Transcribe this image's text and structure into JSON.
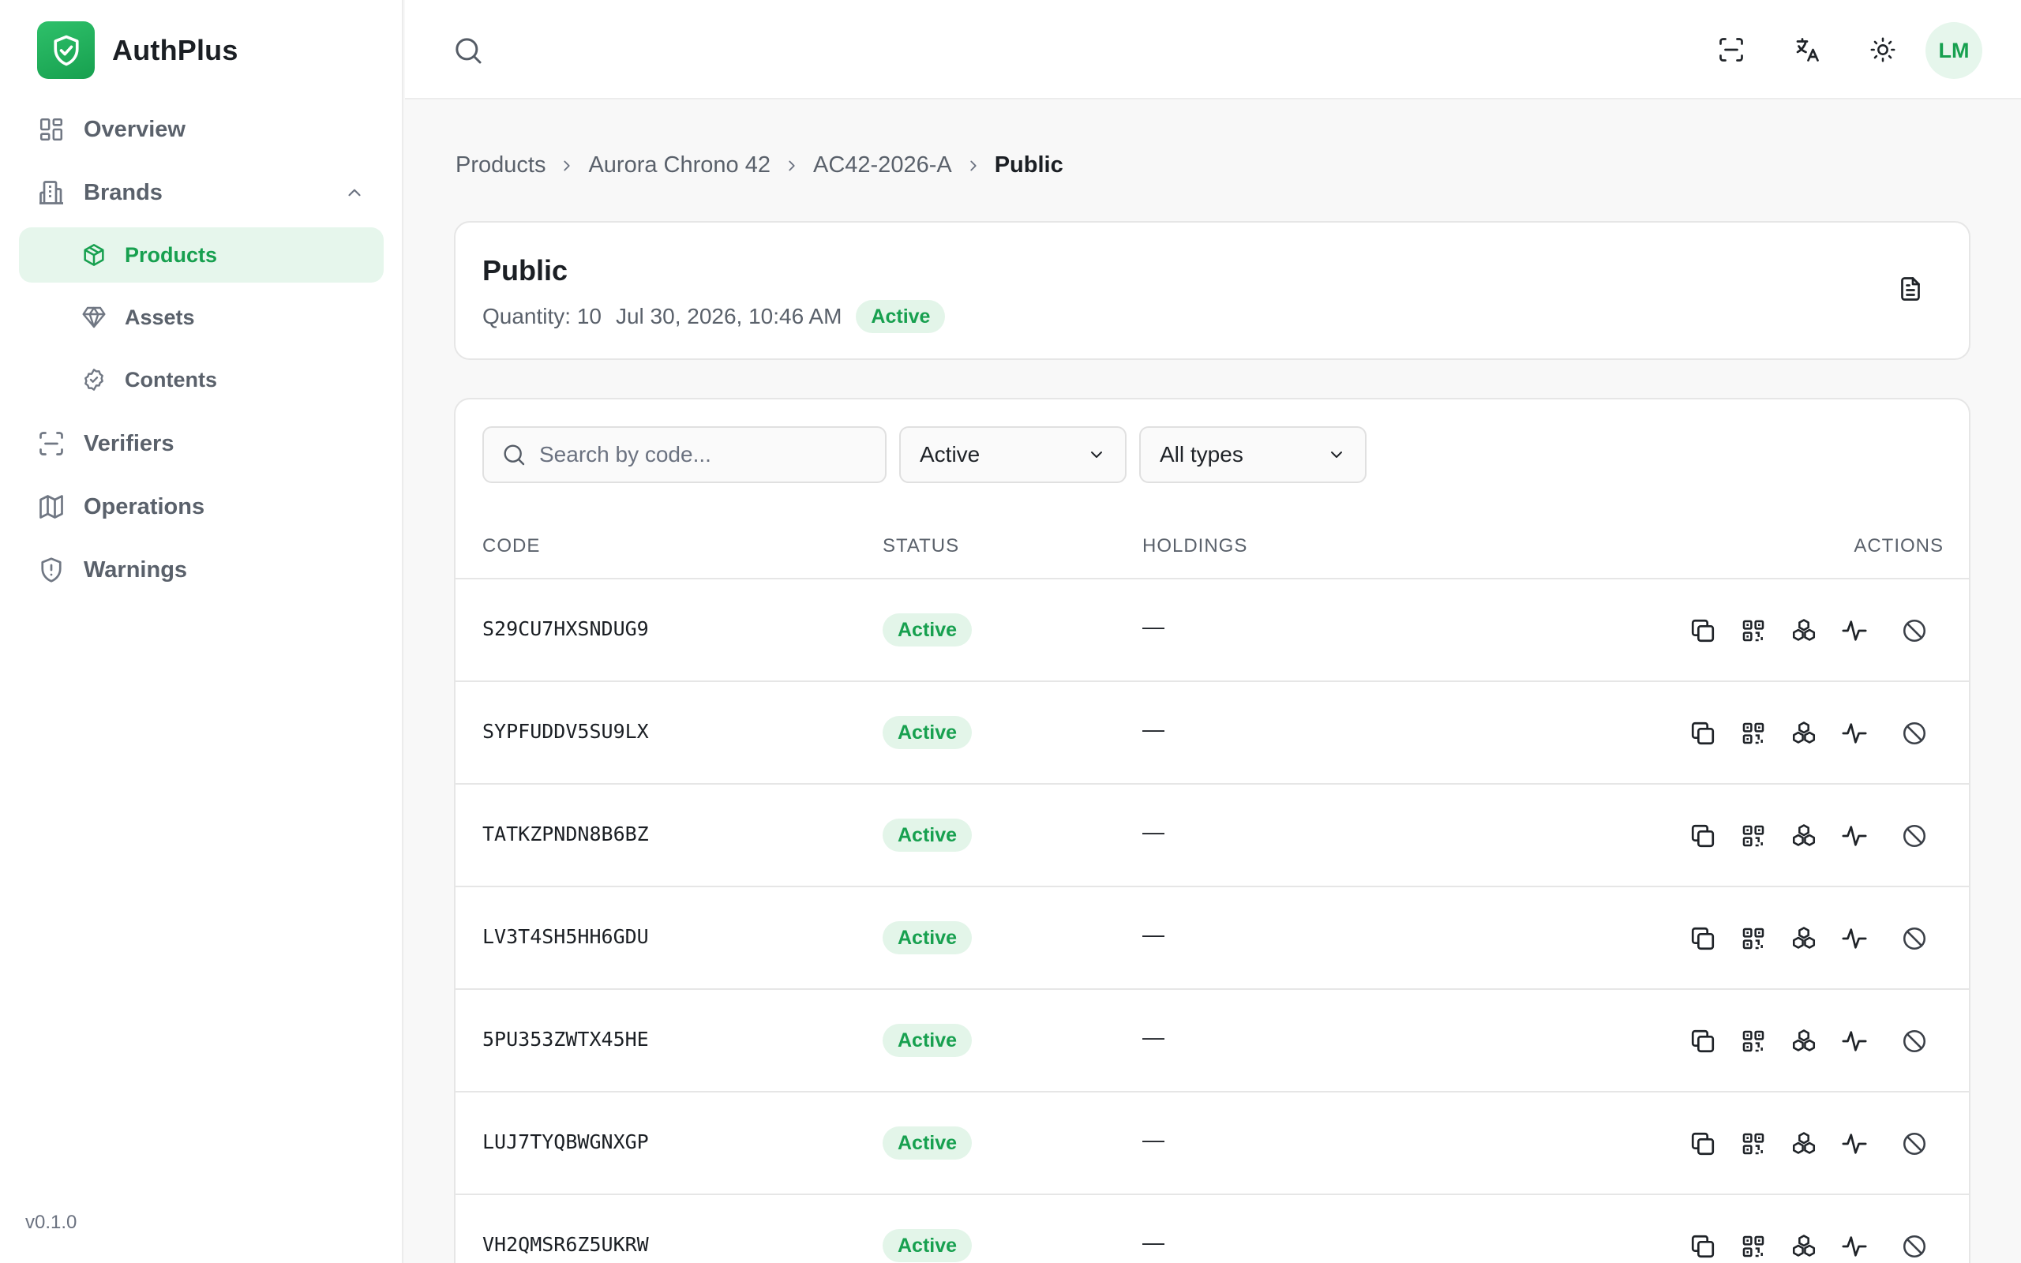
{
  "app": {
    "name": "AuthPlus",
    "version": "v0.1.0"
  },
  "sidebar": {
    "items": [
      {
        "label": "Overview",
        "icon": "layout-grid-icon"
      },
      {
        "label": "Brands",
        "icon": "building-icon",
        "expanded": true
      },
      {
        "label": "Products",
        "icon": "package-icon",
        "active": true
      },
      {
        "label": "Assets",
        "icon": "gem-icon"
      },
      {
        "label": "Contents",
        "icon": "badge-check-icon"
      },
      {
        "label": "Verifiers",
        "icon": "scan-icon"
      },
      {
        "label": "Operations",
        "icon": "map-icon"
      },
      {
        "label": "Warnings",
        "icon": "shield-alert-icon"
      }
    ]
  },
  "header": {
    "avatar_initials": "LM"
  },
  "breadcrumb": [
    "Products",
    "Aurora Chrono 42",
    "AC42-2026-A",
    "Public"
  ],
  "summary": {
    "title": "Public",
    "quantity": "Quantity: 10",
    "date": "Jul 30, 2026, 10:46 AM",
    "status": "Active"
  },
  "filters": {
    "search_placeholder": "Search by code...",
    "status_value": "Active",
    "type_value": "All types"
  },
  "table": {
    "headers": {
      "code": "CODE",
      "status": "STATUS",
      "holdings": "HOLDINGS",
      "actions": "ACTIONS"
    },
    "rows": [
      {
        "code": "S29CU7HXSNDUG9",
        "status": "Active",
        "holdings": "—"
      },
      {
        "code": "SYPFUDDV5SU9LX",
        "status": "Active",
        "holdings": "—"
      },
      {
        "code": "TATKZPNDN8B6BZ",
        "status": "Active",
        "holdings": "—"
      },
      {
        "code": "LV3T4SH5HH6GDU",
        "status": "Active",
        "holdings": "—"
      },
      {
        "code": "5PU353ZWTX45HE",
        "status": "Active",
        "holdings": "—"
      },
      {
        "code": "LUJ7TYQBWGNXGP",
        "status": "Active",
        "holdings": "—"
      },
      {
        "code": "VH2QMSR6Z5UKRW",
        "status": "Active",
        "holdings": "—"
      }
    ]
  },
  "colors": {
    "accent": "#17a04f",
    "accent_bg": "#e6f6ec",
    "border": "#e6e6e6"
  }
}
